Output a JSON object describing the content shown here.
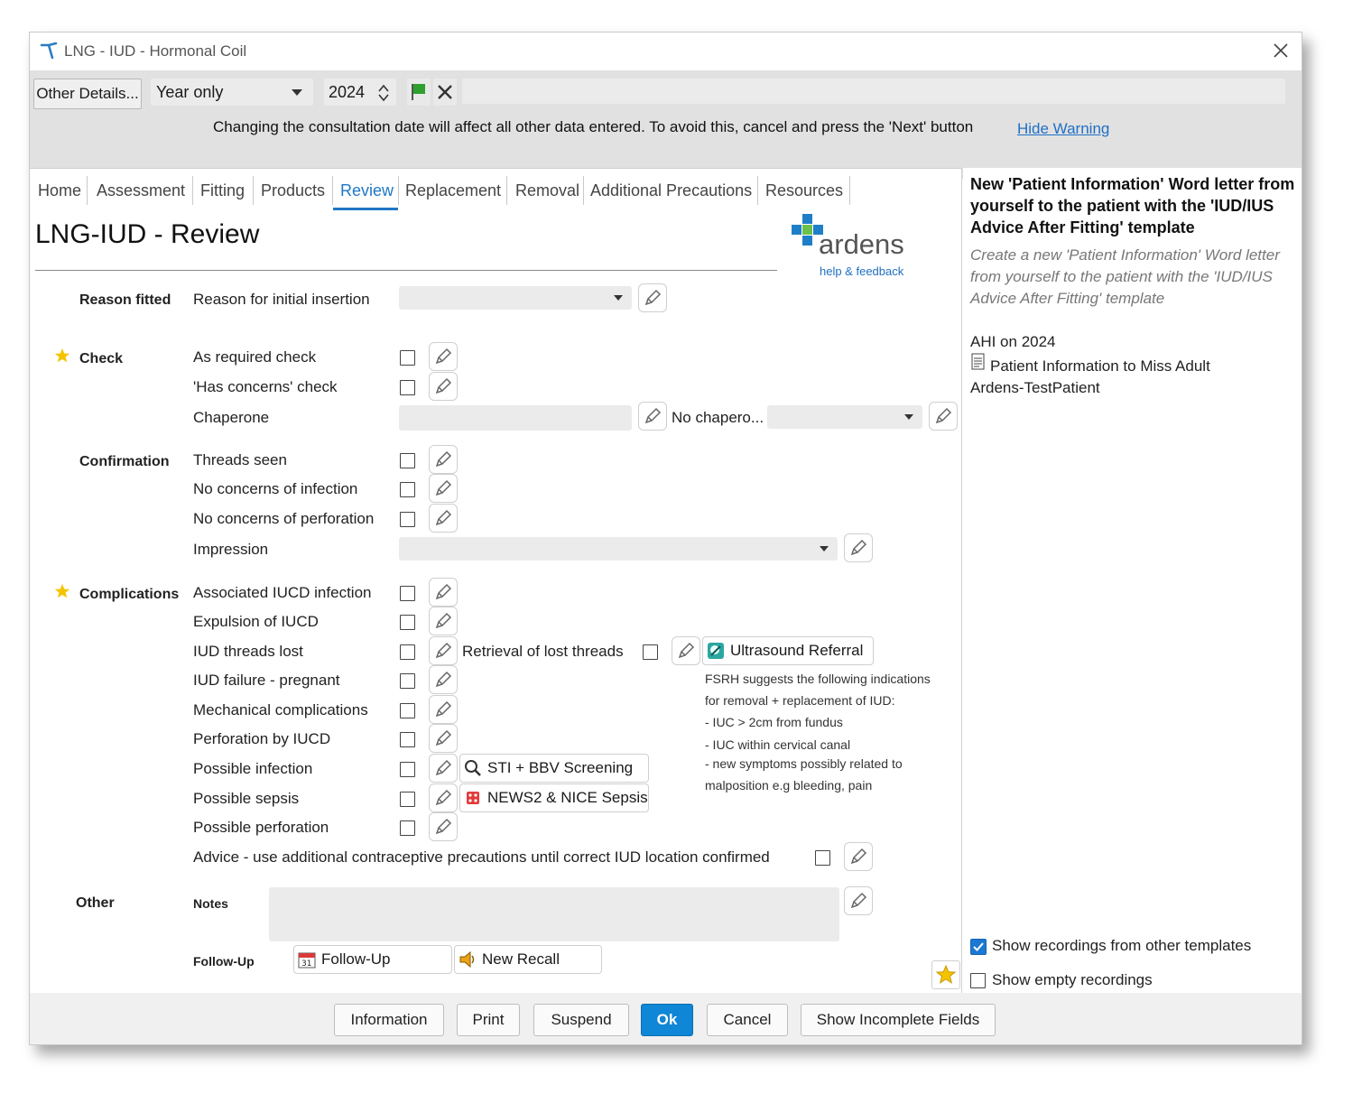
{
  "window": {
    "title": "LNG - IUD - Hormonal Coil"
  },
  "toolbar": {
    "other_details": "Other Details...",
    "date_mode": "Year only",
    "year": "2024",
    "warning": "Changing the consultation date will affect all other data entered. To avoid this, cancel and press the 'Next' button",
    "hide_warning": "Hide Warning"
  },
  "tabs": [
    "Home",
    "Assessment",
    "Fitting",
    "Products",
    "Review",
    "Replacement",
    "Removal",
    "Additional Precautions",
    "Resources"
  ],
  "active_tab": "Review",
  "page": {
    "title": "LNG-IUD - Review",
    "logo_text": "ardens",
    "help_link": "help & feedback"
  },
  "sections": {
    "reason_fitted": "Reason fitted",
    "check": "Check",
    "confirmation": "Confirmation",
    "complications": "Complications",
    "other": "Other"
  },
  "fields": {
    "reason_initial": "Reason for initial insertion",
    "as_required": "As required check",
    "has_concerns": "'Has concerns' check",
    "chaperone": "Chaperone",
    "no_chaperone": "No chapero...",
    "threads_seen": "Threads seen",
    "no_infection": "No concerns of infection",
    "no_perforation": "No concerns of perforation",
    "impression": "Impression",
    "assoc_infection": "Associated IUCD infection",
    "expulsion": "Expulsion of IUCD",
    "threads_lost": "IUD threads lost",
    "retrieval": "Retrieval of lost threads",
    "failure": "IUD failure - pregnant",
    "mechanical": "Mechanical complications",
    "perforation_by": "Perforation by IUCD",
    "possible_infection": "Possible infection",
    "possible_sepsis": "Possible sepsis",
    "possible_perforation": "Possible perforation",
    "advice": "Advice - use additional contraceptive precautions until correct IUD location confirmed",
    "notes": "Notes",
    "follow_up": "Follow-Up"
  },
  "links": {
    "ultrasound": "Ultrasound Referral",
    "sti": "STI + BBV Screening",
    "news2": "NEWS2 & NICE Sepsis",
    "follow_up": "Follow-Up",
    "new_recall": "New Recall"
  },
  "fsrh_note": [
    "FSRH suggests the following indications",
    "for removal + replacement of IUD:",
    "- IUC > 2cm from fundus",
    "- IUC within cervical canal",
    "- new symptoms possibly related to",
    "malposition e.g bleeding, pain"
  ],
  "sidepanel": {
    "heading": "New 'Patient Information' Word letter from yourself to the patient with the 'IUD/IUS Advice After Fitting' template",
    "desc": "Create a new 'Patient Information' Word letter from yourself to the patient with the 'IUD/IUS Advice After Fitting' template",
    "ahi": "AHI on 2024",
    "patient_info": "Patient Information to Miss Adult Ardens-TestPatient",
    "show_other": "Show recordings from other templates",
    "show_empty": "Show empty recordings"
  },
  "footer": {
    "information": "Information",
    "print": "Print",
    "suspend": "Suspend",
    "ok": "Ok",
    "cancel": "Cancel",
    "incomplete": "Show Incomplete Fields"
  },
  "colors": {
    "accent": "#0f86d6",
    "tab_active": "#1f77c6",
    "star": "#f5c400",
    "logo_blue": "#1e7fc8",
    "toolbar_bg": "#e1e1e1"
  },
  "icons": [
    "app-icon",
    "close-icon",
    "green-flag-icon",
    "clear-x-icon",
    "pencil-icon",
    "star-icon",
    "ultrasound-icon",
    "search-icon",
    "news2-icon",
    "calendar-icon",
    "recall-icon",
    "document-icon"
  ]
}
